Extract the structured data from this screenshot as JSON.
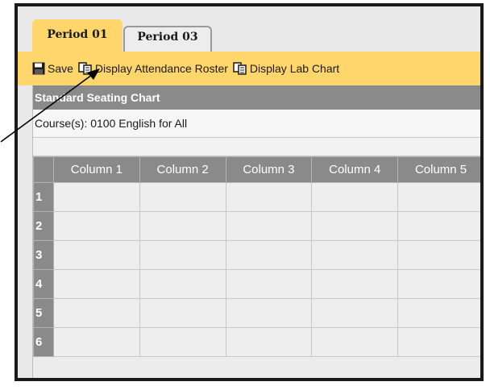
{
  "tabs": [
    {
      "label": "Period 01",
      "active": true
    },
    {
      "label": "Period 03",
      "active": false
    }
  ],
  "toolbar": {
    "save_label": "Save",
    "display_attendance_label": "Display Attendance Roster",
    "display_lab_label": "Display Lab Chart"
  },
  "panel": {
    "title": "Standard Seating Chart",
    "course_line": "Course(s): 0100 English for All"
  },
  "grid": {
    "columns": [
      "Column 1",
      "Column 2",
      "Column 3",
      "Column 4",
      "Column 5"
    ],
    "rows": [
      "1",
      "2",
      "3",
      "4",
      "5",
      "6"
    ]
  },
  "colors": {
    "accent": "#ffd66b",
    "header_gray": "#8a8a8a"
  },
  "icons": {
    "save": "floppy-disk-icon",
    "display": "copy-document-icon"
  }
}
